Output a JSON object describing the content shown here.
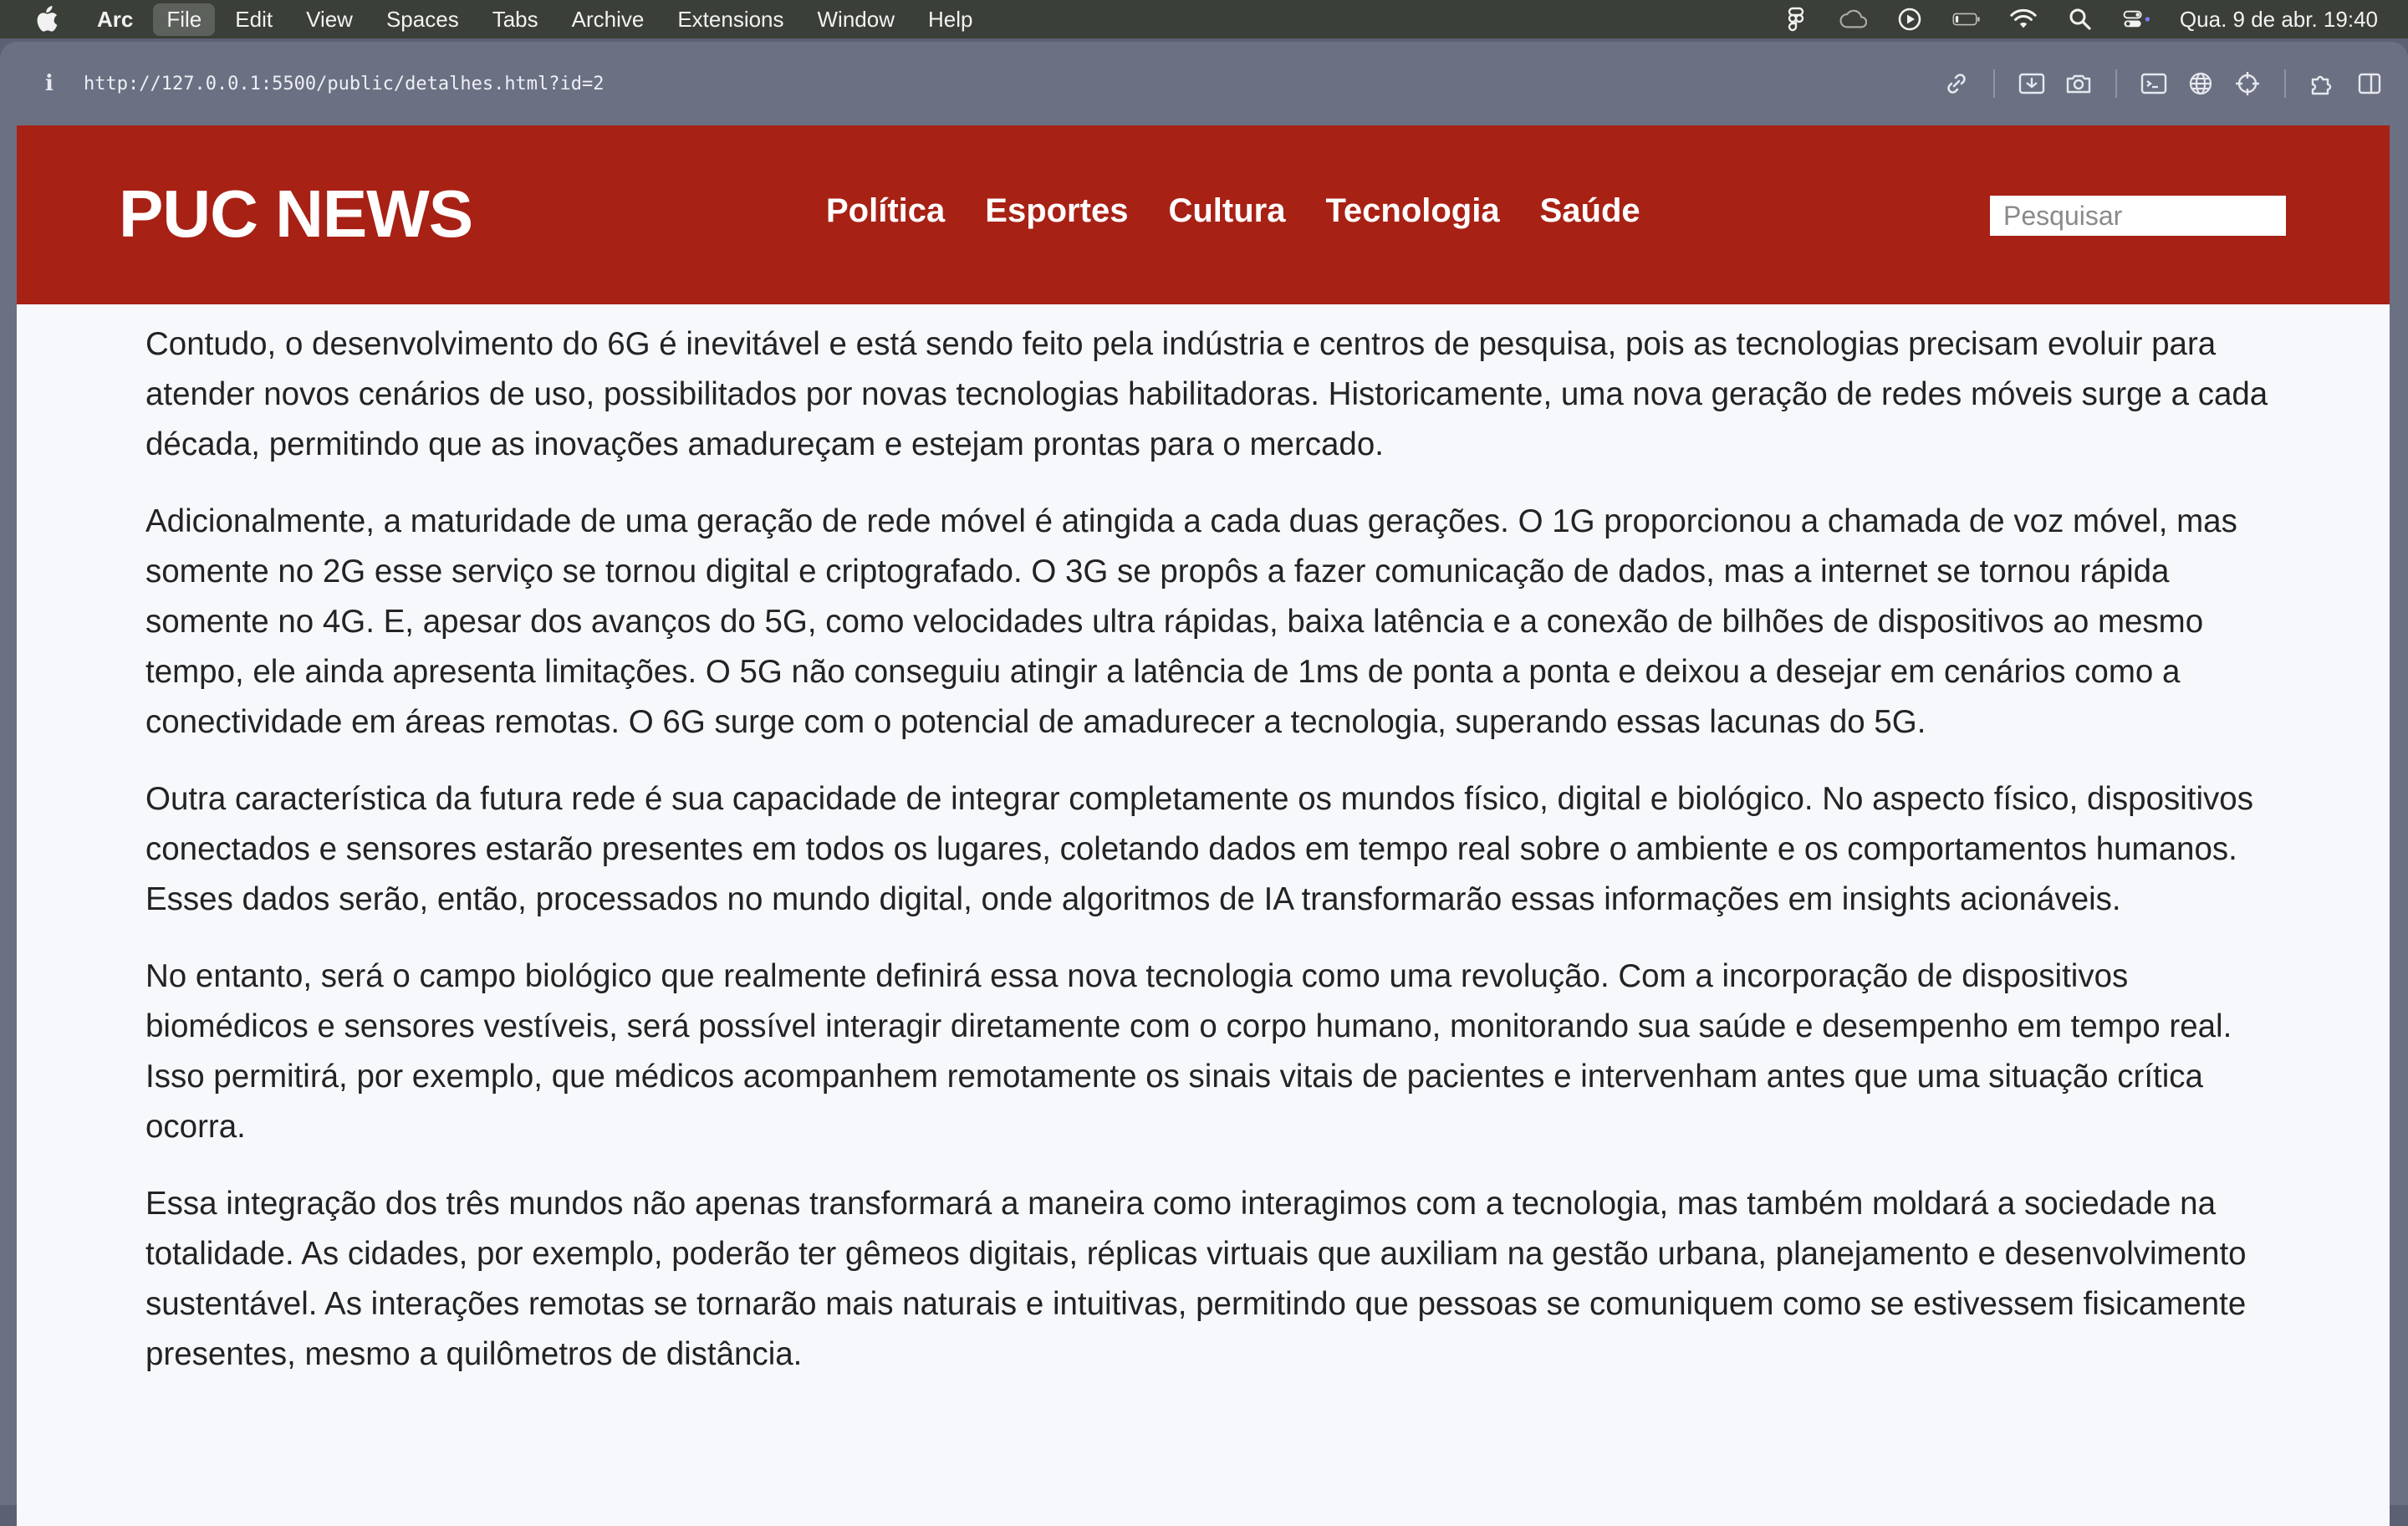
{
  "menubar": {
    "app_name": "Arc",
    "items": [
      "File",
      "Edit",
      "View",
      "Spaces",
      "Tabs",
      "Archive",
      "Extensions",
      "Window",
      "Help"
    ],
    "active_item": "File",
    "clock": "Qua. 9 de abr.  19:40"
  },
  "browser": {
    "url": "http://127.0.0.1:5500/public/detalhes.html?id=2"
  },
  "site": {
    "logo": "PUC NEWS",
    "nav": [
      "Política",
      "Esportes",
      "Cultura",
      "Tecnologia",
      "Saúde"
    ],
    "search_placeholder": "Pesquisar",
    "header_color": "#a82115"
  },
  "article": {
    "paragraphs": [
      "Contudo, o desenvolvimento do 6G é inevitável e está sendo feito pela indústria e centros de pesquisa, pois as tecnologias precisam evoluir para atender novos cenários de uso, possibilitados por novas tecnologias habilitadoras. Historicamente, uma nova geração de redes móveis surge a cada década, permitindo que as inovações amadureçam e estejam prontas para o mercado.",
      "Adicionalmente, a maturidade de uma geração de rede móvel é atingida a cada duas gerações. O 1G proporcionou a chamada de voz móvel, mas somente no 2G esse serviço se tornou digital e criptografado. O 3G se propôs a fazer comunicação de dados, mas a internet se tornou rápida somente no 4G. E, apesar dos avanços do 5G, como velocidades ultra rápidas, baixa latência e a conexão de bilhões de dispositivos ao mesmo tempo, ele ainda apresenta limitações. O 5G não conseguiu atingir a latência de 1ms de ponta a ponta e deixou a desejar em cenários como a conectividade em áreas remotas. O 6G surge com o potencial de amadurecer a tecnologia, superando essas lacunas do 5G.",
      "Outra característica da futura rede é sua capacidade de integrar completamente os mundos físico, digital e biológico. No aspecto físico, dispositivos conectados e sensores estarão presentes em todos os lugares, coletando dados em tempo real sobre o ambiente e os comportamentos humanos. Esses dados serão, então, processados no mundo digital, onde algoritmos de IA transformarão essas informações em insights acionáveis.",
      "No entanto, será o campo biológico que realmente definirá essa nova tecnologia como uma revolução. Com a incorporação de dispositivos biomédicos e sensores vestíveis, será possível interagir diretamente com o corpo humano, monitorando sua saúde e desempenho em tempo real. Isso permitirá, por exemplo, que médicos acompanhem remotamente os sinais vitais de pacientes e intervenham antes que uma situação crítica ocorra.",
      "Essa integração dos três mundos não apenas transformará a maneira como interagimos com a tecnologia, mas também moldará a sociedade na totalidade. As cidades, por exemplo, poderão ter gêmeos digitais, réplicas virtuais que auxiliam na gestão urbana, planejamento e desenvolvimento sustentável. As interações remotas se tornarão mais naturais e intuitivas, permitindo que pessoas se comuniquem como se estivessem fisicamente presentes, mesmo a quilômetros de distância."
    ]
  }
}
